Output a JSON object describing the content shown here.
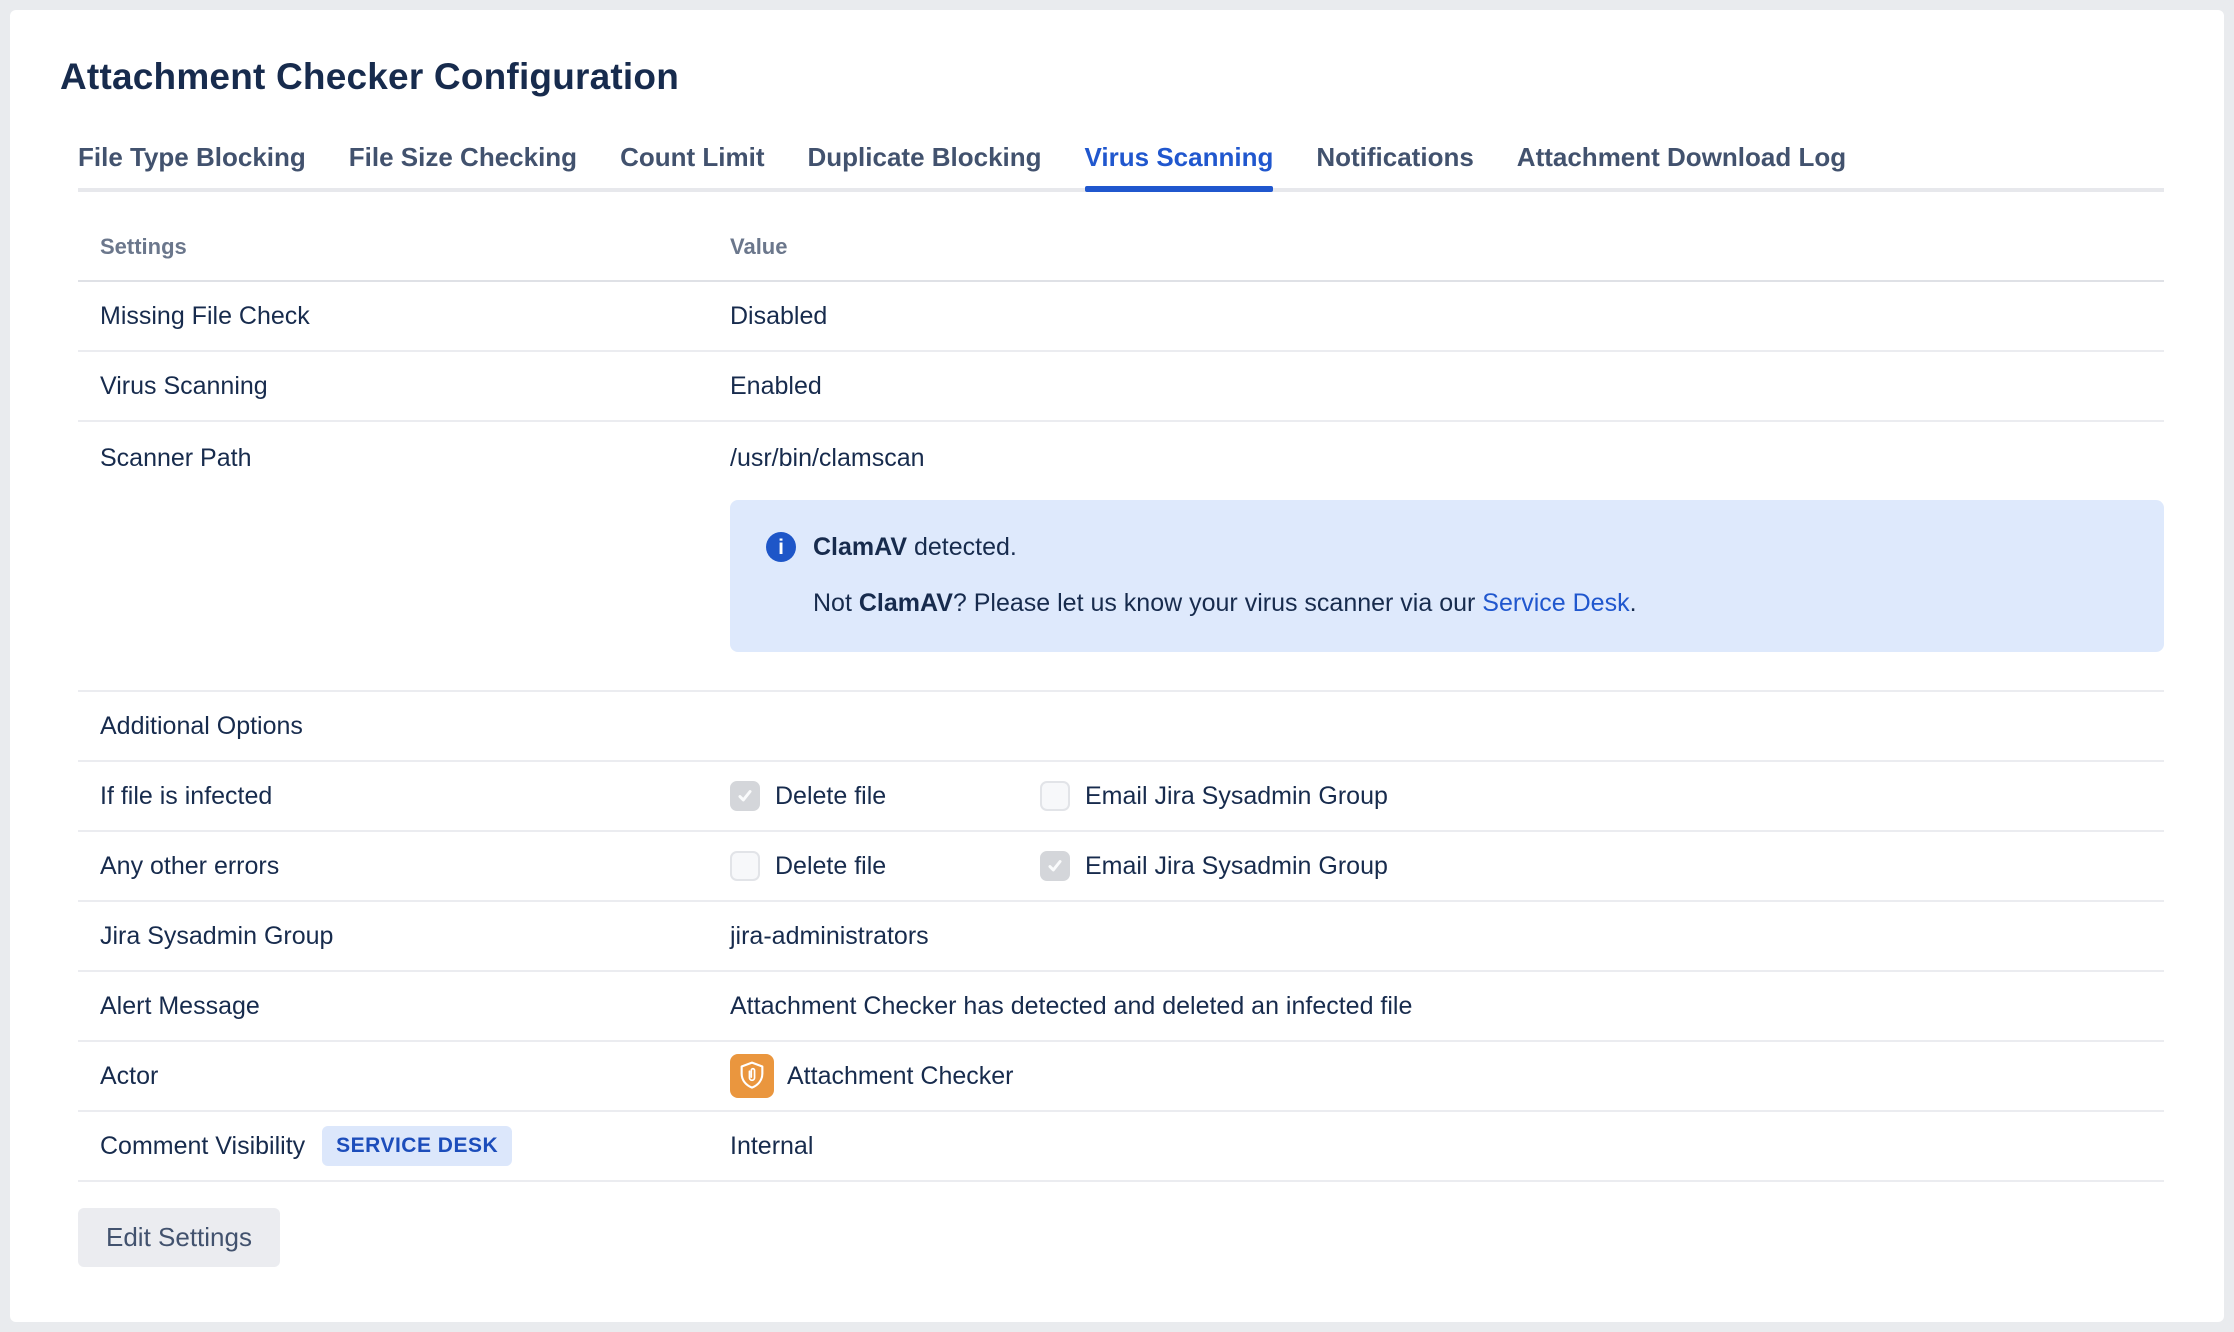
{
  "page": {
    "title": "Attachment Checker Configuration"
  },
  "tabs": [
    {
      "label": "File Type Blocking",
      "active": false
    },
    {
      "label": "File Size Checking",
      "active": false
    },
    {
      "label": "Count Limit",
      "active": false
    },
    {
      "label": "Duplicate Blocking",
      "active": false
    },
    {
      "label": "Virus Scanning",
      "active": true
    },
    {
      "label": "Notifications",
      "active": false
    },
    {
      "label": "Attachment Download Log",
      "active": false
    }
  ],
  "table": {
    "headers": {
      "settings": "Settings",
      "value": "Value"
    },
    "rows": {
      "missing_file_check": {
        "label": "Missing File Check",
        "value": "Disabled"
      },
      "virus_scanning": {
        "label": "Virus Scanning",
        "value": "Enabled"
      },
      "scanner_path": {
        "label": "Scanner Path",
        "value": "/usr/bin/clamscan"
      },
      "additional_options": {
        "label": "Additional Options"
      },
      "if_file_infected": {
        "label": "If file is infected",
        "checkbox1": {
          "label": "Delete file",
          "checked": true
        },
        "checkbox2": {
          "label": "Email Jira Sysadmin Group",
          "checked": false
        }
      },
      "any_other_errors": {
        "label": "Any other errors",
        "checkbox1": {
          "label": "Delete file",
          "checked": false
        },
        "checkbox2": {
          "label": "Email Jira Sysadmin Group",
          "checked": true
        }
      },
      "jira_sysadmin_group": {
        "label": "Jira Sysadmin Group",
        "value": "jira-administrators"
      },
      "alert_message": {
        "label": "Alert Message",
        "value": "Attachment Checker has detected and deleted an infected file"
      },
      "actor": {
        "label": "Actor",
        "value": "Attachment Checker",
        "icon": "shield-paperclip-icon"
      },
      "comment_visibility": {
        "label": "Comment Visibility",
        "badge": "SERVICE DESK",
        "value": "Internal"
      }
    }
  },
  "info_box": {
    "icon": "info-icon",
    "line1_bold": "ClamAV",
    "line1_rest": " detected.",
    "line2_prefix": "Not ",
    "line2_bold": "ClamAV",
    "line2_mid": "? Please let us know your virus scanner via our ",
    "line2_link": "Service Desk",
    "line2_suffix": "."
  },
  "actions": {
    "edit_button": "Edit Settings"
  },
  "colors": {
    "accent_blue": "#2057CE",
    "info_icon_blue": "#1E56C8",
    "info_box_bg": "#DEE9FC",
    "badge_bg": "#DCE7FB",
    "badge_text": "#1C4DBB",
    "actor_orange": "#EA963E",
    "text_dark": "#172B4D",
    "tab_inactive": "#42526E",
    "header_gray": "#6B778C",
    "button_bg": "#EBECF0",
    "page_bg": "#E9EBEE"
  }
}
